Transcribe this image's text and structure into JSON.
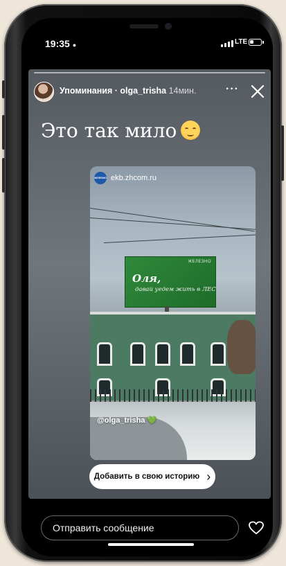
{
  "status_bar": {
    "time": "19:35",
    "network": "LTE"
  },
  "story": {
    "header": {
      "title": "Упоминания · olga_trisha",
      "time": "14мин."
    },
    "caption_text": "Это так мило",
    "post": {
      "site": "ekb.zhcom.ru",
      "site_logo_text": "ЖЕЛЕЗНО",
      "billboard": {
        "brand": "ЖЕЛЕЗНО",
        "line1": "Оля,",
        "line2": "давай уедем жить в ЛЕС"
      },
      "mention": "@olga_trisha",
      "mention_emoji": "💚"
    },
    "add_to_story_label": "Добавить в свою историю"
  },
  "reply": {
    "placeholder": "Отправить сообщение"
  },
  "icons": {
    "close": "close-icon",
    "more": "more-icon",
    "like": "heart-icon",
    "chevron": "chevron-right-icon"
  },
  "colors": {
    "billboard_green": "#2f8a3a",
    "button_white": "#ffffff"
  }
}
